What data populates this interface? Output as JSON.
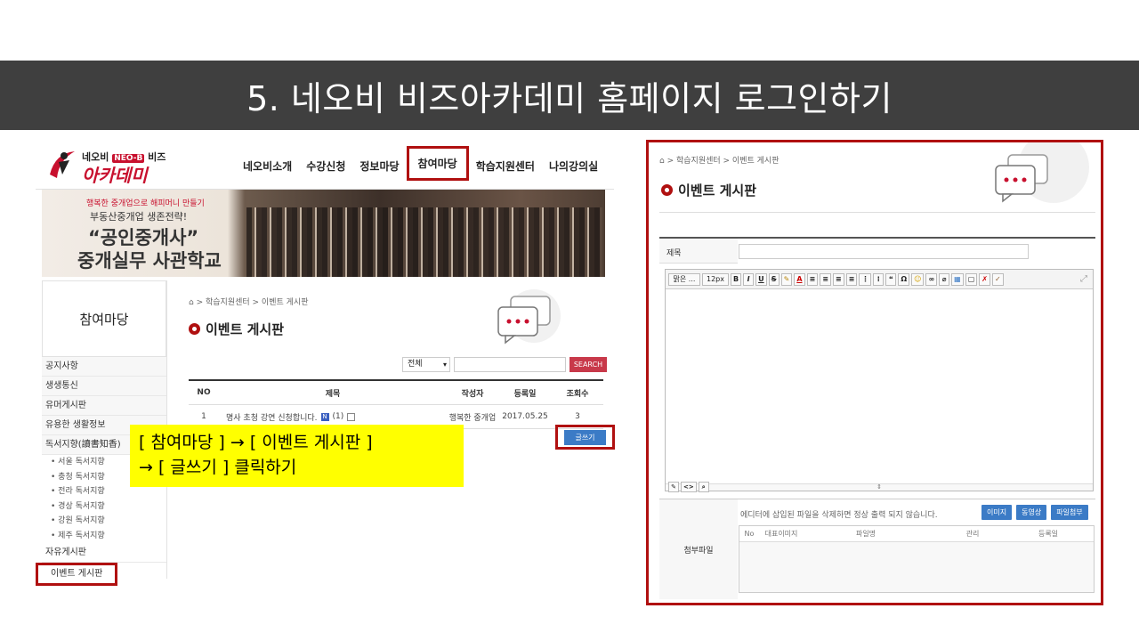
{
  "slide": {
    "title": "5. 네오비 비즈아카데미 홈페이지 로그인하기",
    "callout_line1": "[ 참여마당 ] → [ 이벤트 게시판 ]",
    "callout_line2": "→ [ 글쓰기 ] 클릭하기"
  },
  "site": {
    "logo_small_prefix": "네오비",
    "logo_badge": "NEO-B",
    "logo_small_suffix": "비즈",
    "logo_big": "아카데미",
    "nav": [
      "네오비소개",
      "수강신청",
      "정보마당",
      "참여마당",
      "학습지원센터",
      "나의강의실"
    ]
  },
  "banner": {
    "line1": "행복한 중개업으로 해피머니 만들기",
    "line2": "부동산중개업 생존전략!",
    "line3": "“공인중개사”",
    "line4": "중개실무 사관학교"
  },
  "sidebar": {
    "title": "참여마당",
    "items_top": [
      "공지사항",
      "생생통신",
      "유머게시판",
      "유용한 생활정보",
      "독서지향(讀書知香)"
    ],
    "sub_items": [
      "서울 독서지향",
      "충청 독서지향",
      "전라 독서지향",
      "경상 독서지향",
      "강원 독서지향",
      "제주 독서지향"
    ],
    "items_bottom": [
      "자유게시판",
      "이벤트 게시판"
    ]
  },
  "board": {
    "breadcrumb": "학습지원센터 > 이벤트 게시판",
    "title": "이벤트 게시판",
    "search_select": "전체",
    "search_button": "SEARCH",
    "columns": [
      "NO",
      "제목",
      "작성자",
      "등록일",
      "조회수"
    ],
    "rows": [
      {
        "no": "1",
        "title": "명사 초청 강연 신청합니다.",
        "new": "N",
        "comments": "(1)",
        "author": "행복한 중개업",
        "date": "2017.05.25",
        "views": "3"
      }
    ],
    "write_button": "글쓰기"
  },
  "write_form": {
    "breadcrumb": "학습지원센터 > 이벤트 게시판",
    "title": "이벤트 게시판",
    "subject_label": "제목",
    "font_select": "맑은 ...",
    "size_select": "12px",
    "toolbar_buttons": [
      "B",
      "I",
      "U",
      "S",
      "❝",
      "Ω"
    ],
    "attach_label": "첨부파일",
    "attach_note": "에디터에 삽입된 파일을 삭제하면 정상 출력 되지 않습니다.",
    "attach_buttons": [
      "이미지",
      "동영상",
      "파일첨부"
    ],
    "file_columns": [
      "No",
      "대표이미지",
      "파일명",
      "관리",
      "등록일"
    ]
  },
  "colors": {
    "highlight_border": "#b01010",
    "brand_red": "#c8102e",
    "button_blue": "#3b7bc6",
    "callout_yellow": "#ffff00",
    "title_bar": "#3f3f3f"
  }
}
